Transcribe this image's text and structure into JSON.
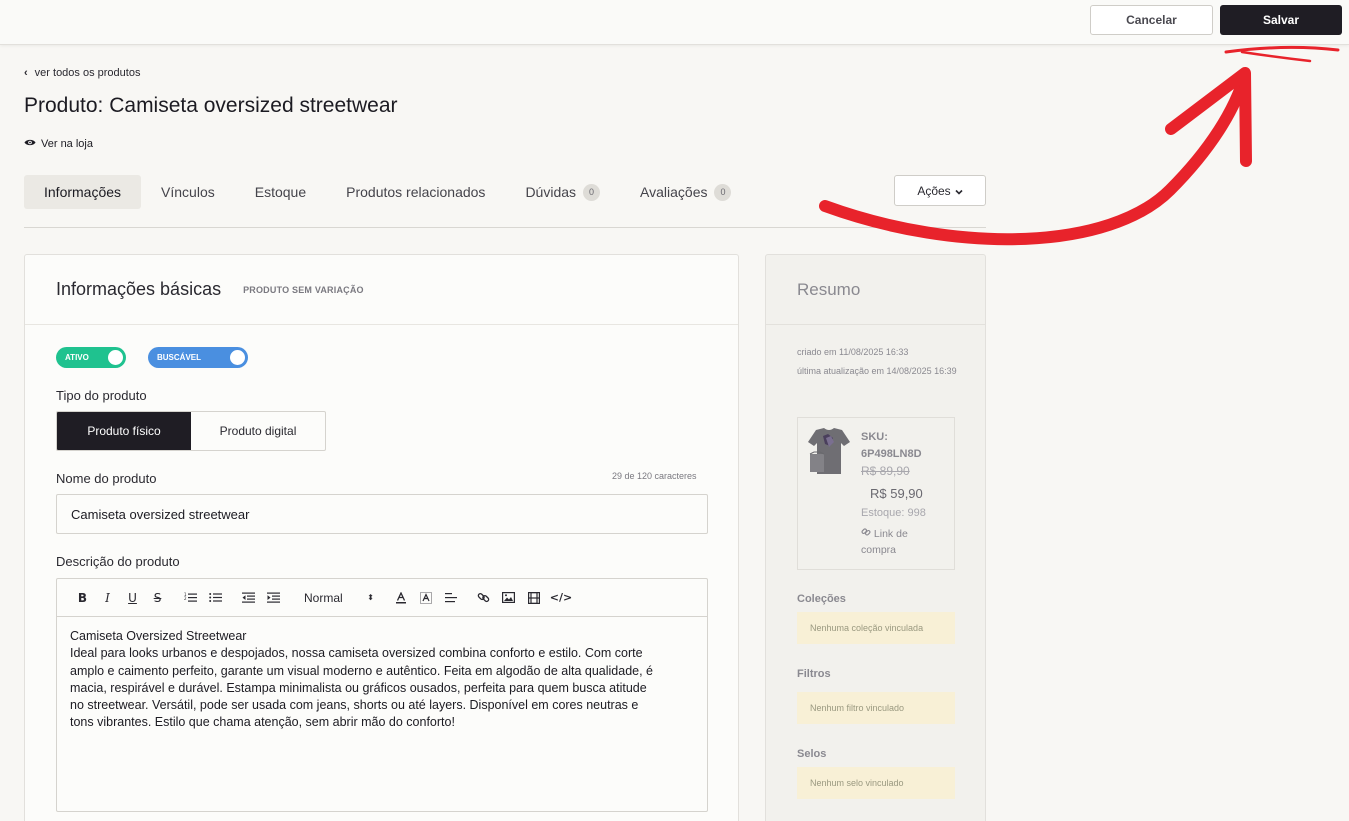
{
  "topbar": {
    "cancel_label": "Cancelar",
    "save_label": "Salvar"
  },
  "nav": {
    "back_label": "ver todos os produtos",
    "view_store_label": "Ver na loja"
  },
  "page": {
    "title": "Produto: Camiseta oversized streetwear"
  },
  "tabs": [
    {
      "label": "Informações",
      "active": true
    },
    {
      "label": "Vínculos"
    },
    {
      "label": "Estoque"
    },
    {
      "label": "Produtos relacionados"
    },
    {
      "label": "Dúvidas",
      "badge": "0"
    },
    {
      "label": "Avaliações",
      "badge": "0"
    }
  ],
  "actions": {
    "label": "Ações"
  },
  "basic": {
    "title": "Informações básicas",
    "subtitle": "PRODUTO SEM VARIAÇÃO",
    "toggle_active": "ATIVO",
    "toggle_searchable": "BUSCÁVEL",
    "product_type_label": "Tipo do produto",
    "type_options": [
      "Produto físico",
      "Produto digital"
    ],
    "type_selected": "Produto físico",
    "name_label": "Nome do produto",
    "char_count": "29 de 120 caracteres",
    "name_value": "Camiseta oversized streetwear",
    "description_label": "Descrição do produto",
    "editor_format": "Normal",
    "description_title": "Camiseta Oversized Streetwear",
    "description_lines": [
      "Ideal para looks urbanos e despojados, nossa camiseta oversized combina conforto e estilo. Com corte",
      "amplo e caimento perfeito, garante um visual moderno e autêntico. Feita em algodão de alta qualidade, é",
      "macia, respirável e durável. Estampa minimalista ou gráficos ousados, perfeita para quem busca atitude",
      "no streetwear. Versátil, pode ser usada com jeans, shorts ou até layers. Disponível em cores neutras e",
      "tons vibrantes. Estilo que chama atenção, sem abrir mão do conforto!"
    ]
  },
  "summary": {
    "title": "Resumo",
    "created": "criado em 11/08/2025 16:33",
    "updated": "última atualização em 14/08/2025 16:39",
    "sku_label": "SKU:",
    "sku_value": "6P498LN8D",
    "price_old": "R$ 89,90",
    "price_new": "R$ 59,90",
    "stock": "Estoque: 998",
    "buy_link": "Link de compra",
    "collections_title": "Coleções",
    "collections_empty": "Nenhuma coleção vinculada",
    "filters_title": "Filtros",
    "filters_empty": "Nenhum filtro vinculado",
    "seals_title": "Selos",
    "seals_empty": "Nenhum selo vinculado"
  },
  "colors": {
    "primary_dark": "#1f1d24",
    "toggle_active": "#1fc28f",
    "toggle_searchable": "#4a8fe0",
    "annotation_red": "#e8232b",
    "empty_note_bg": "#f8f0d6"
  },
  "icons": [
    "chevron-left-icon",
    "eye-icon",
    "chevron-down-icon",
    "link-icon",
    "bold-icon",
    "italic-icon",
    "underline-icon",
    "strikethrough-icon",
    "ordered-list-icon",
    "bullet-list-icon",
    "outdent-icon",
    "indent-icon",
    "text-color-icon",
    "background-color-icon",
    "align-icon",
    "insert-link-icon",
    "image-icon",
    "video-icon",
    "code-icon"
  ]
}
